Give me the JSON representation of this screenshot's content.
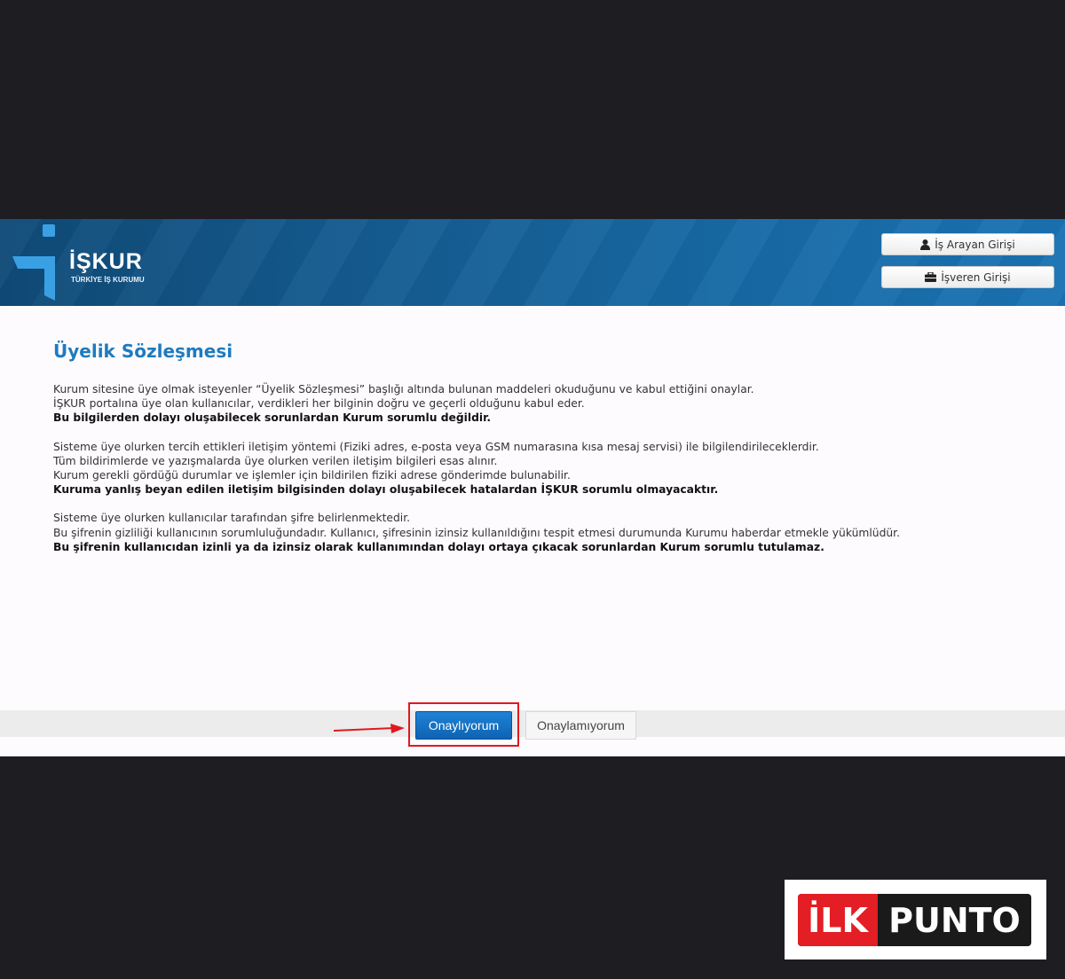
{
  "header": {
    "logo_title": "İŞKUR",
    "logo_subtitle": "TÜRKİYE İŞ KURUMU",
    "job_seeker_login": "İş Arayan Girişi",
    "employer_login": "İşveren Girişi"
  },
  "agreement": {
    "title": "Üyelik Sözleşmesi",
    "sections": [
      {
        "lines": [
          "Kurum sitesine üye olmak isteyenler “Üyelik Sözleşmesi” başlığı altında bulunan maddeleri okuduğunu ve kabul ettiğini onaylar.",
          "İŞKUR portalına üye olan kullanıcılar, verdikleri her bilginin doğru ve geçerli olduğunu kabul eder."
        ],
        "bold": "Bu bilgilerden dolayı oluşabilecek sorunlardan Kurum sorumlu değildir."
      },
      {
        "lines": [
          "Sisteme üye olurken tercih ettikleri iletişim yöntemi (Fiziki adres, e-posta veya GSM numarasına kısa mesaj servisi) ile bilgilendirileceklerdir.",
          "Tüm bildirimlerde ve yazışmalarda üye olurken verilen iletişim bilgileri esas alınır.",
          "Kurum gerekli gördüğü durumlar ve işlemler için bildirilen fiziki adrese gönderimde bulunabilir."
        ],
        "bold": "Kuruma yanlış beyan edilen iletişim bilgisinden dolayı oluşabilecek hatalardan İŞKUR sorumlu olmayacaktır."
      },
      {
        "lines": [
          "Sisteme üye olurken kullanıcılar tarafından şifre belirlenmektedir.",
          "Bu şifrenin gizliliği kullanıcının sorumluluğundadır. Kullanıcı, şifresinin izinsiz kullanıldığını tespit etmesi durumunda Kurumu haberdar etmekle yükümlüdür."
        ],
        "bold": "Bu şifrenin kullanıcıdan izinli ya da izinsiz olarak kullanımından dolayı ortaya çıkacak sorunlardan Kurum sorumlu tutulamaz."
      }
    ]
  },
  "actions": {
    "approve": "Onaylıyorum",
    "reject": "Onaylamıyorum"
  },
  "watermark": {
    "left": "İLK",
    "right": "PUNTO"
  },
  "colors": {
    "accent": "#1e7bbf",
    "approve_button": "#0e63b3",
    "highlight": "#e0191e",
    "header": "#155c91"
  },
  "icons": [
    "user-icon",
    "briefcase-icon",
    "arrow-right-icon"
  ]
}
